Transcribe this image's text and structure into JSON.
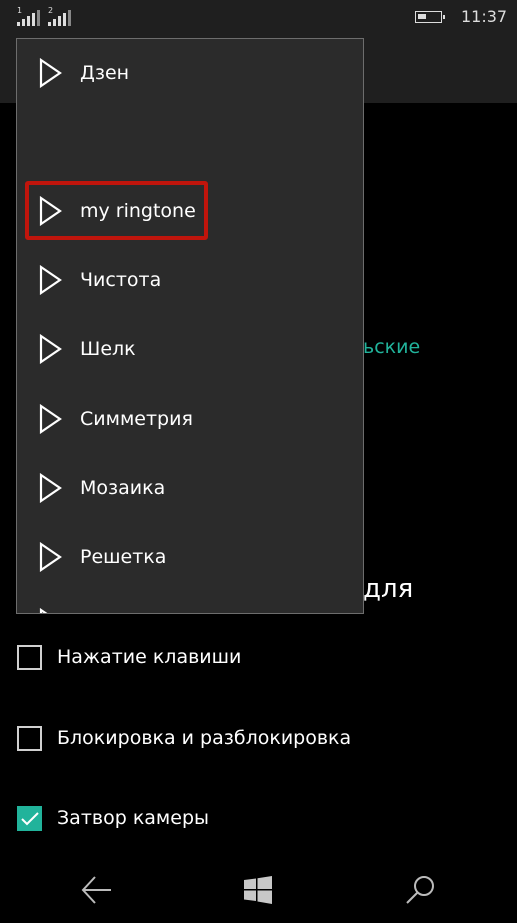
{
  "status_bar": {
    "sim1_label": "1",
    "sim2_label": "2",
    "battery_icon": "battery-low-icon",
    "time": "11:37"
  },
  "background": {
    "partial_green_text": "ьские",
    "partial_heading_text": "для",
    "checkboxes": [
      {
        "label": "Нажатие клавиши",
        "checked": false
      },
      {
        "label": "Блокировка и разблокировка",
        "checked": false
      },
      {
        "label": "Затвор камеры",
        "checked": true
      }
    ],
    "accent_color": "#21b39b"
  },
  "ringtone_popup": {
    "items": [
      {
        "label": "Дзен",
        "icon": "play-icon"
      },
      {
        "label": "my ringtone",
        "icon": "play-icon",
        "highlighted": true
      },
      {
        "label": "Чистота",
        "icon": "play-icon"
      },
      {
        "label": "Шелк",
        "icon": "play-icon"
      },
      {
        "label": "Симметрия",
        "icon": "play-icon"
      },
      {
        "label": "Мозаика",
        "icon": "play-icon"
      },
      {
        "label": "Решетка",
        "icon": "play-icon"
      }
    ],
    "highlight_color": "#c0150c"
  },
  "nav_bar": {
    "back_icon": "back-arrow-icon",
    "home_icon": "windows-logo-icon",
    "search_icon": "search-icon"
  }
}
